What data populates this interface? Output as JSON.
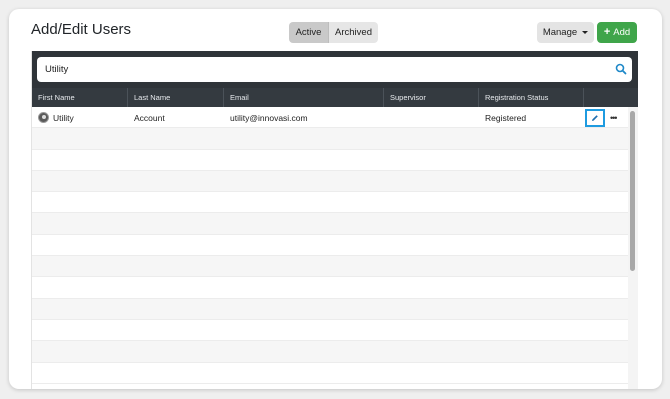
{
  "header": {
    "title": "Add/Edit Users",
    "segments": [
      "Active",
      "Archived"
    ],
    "active_segment": "Active",
    "manage_label": "Manage",
    "add_label": "Add"
  },
  "search": {
    "value": "Utility",
    "icon": "search-icon"
  },
  "table": {
    "columns": [
      "First Name",
      "Last Name",
      "Email",
      "Supervisor",
      "Registration Status"
    ],
    "rows": [
      {
        "first_name": "Utility",
        "last_name": "Account",
        "email": "utility@innovasi.com",
        "supervisor": "",
        "status": "Registered"
      }
    ]
  },
  "colors": {
    "accent_green": "#3fa54a",
    "header_dark": "#343a40",
    "highlight_blue": "#1e9be0"
  },
  "icons": {
    "edit": "pencil-icon",
    "more": "ellipsis-icon",
    "avatar": "avatar"
  }
}
